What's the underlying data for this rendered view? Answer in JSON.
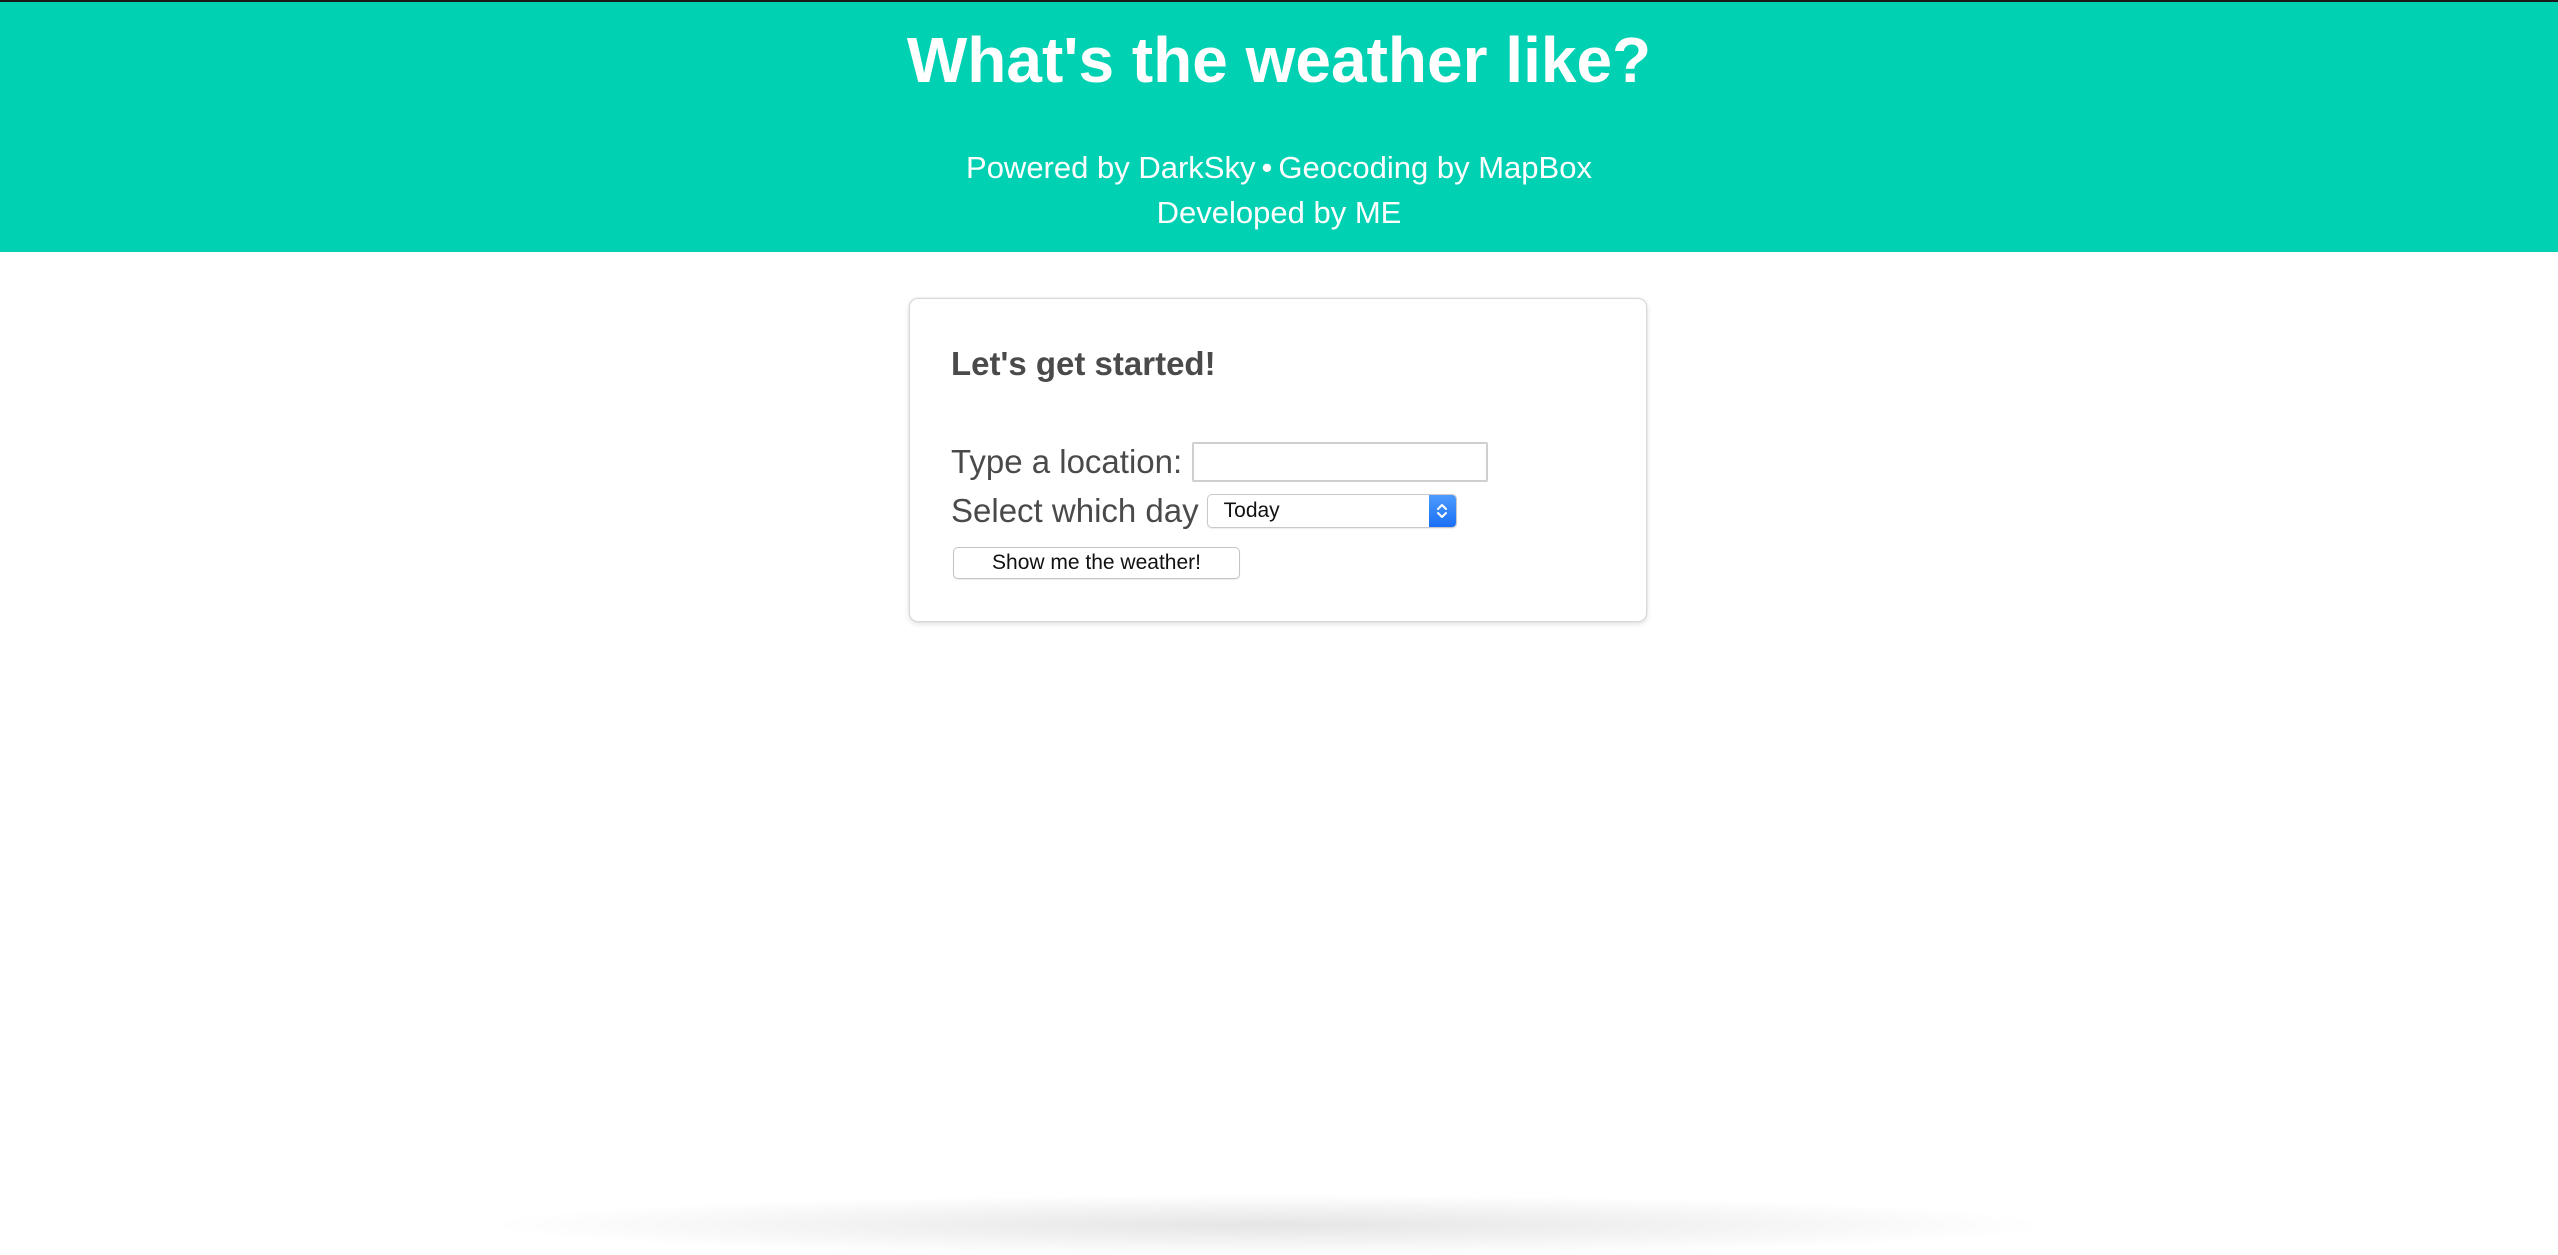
{
  "header": {
    "title": "What's the weather like?",
    "powered_prefix": "Powered by DarkSky",
    "separator": "•",
    "geocoding_text": "Geocoding by MapBox",
    "developed_by": "Developed by ME"
  },
  "form": {
    "heading": "Let's get started!",
    "location_label": "Type a location:",
    "location_value": "",
    "location_placeholder": "",
    "day_label": "Select which day",
    "day_selected": "Today",
    "submit_label": "Show me the weather!"
  },
  "colors": {
    "hero_background": "#00d1b2",
    "text": "#4a4a4a",
    "select_accent": "#1a6ff5"
  },
  "icons": {
    "select_stepper": "up-down-chevron-icon"
  }
}
